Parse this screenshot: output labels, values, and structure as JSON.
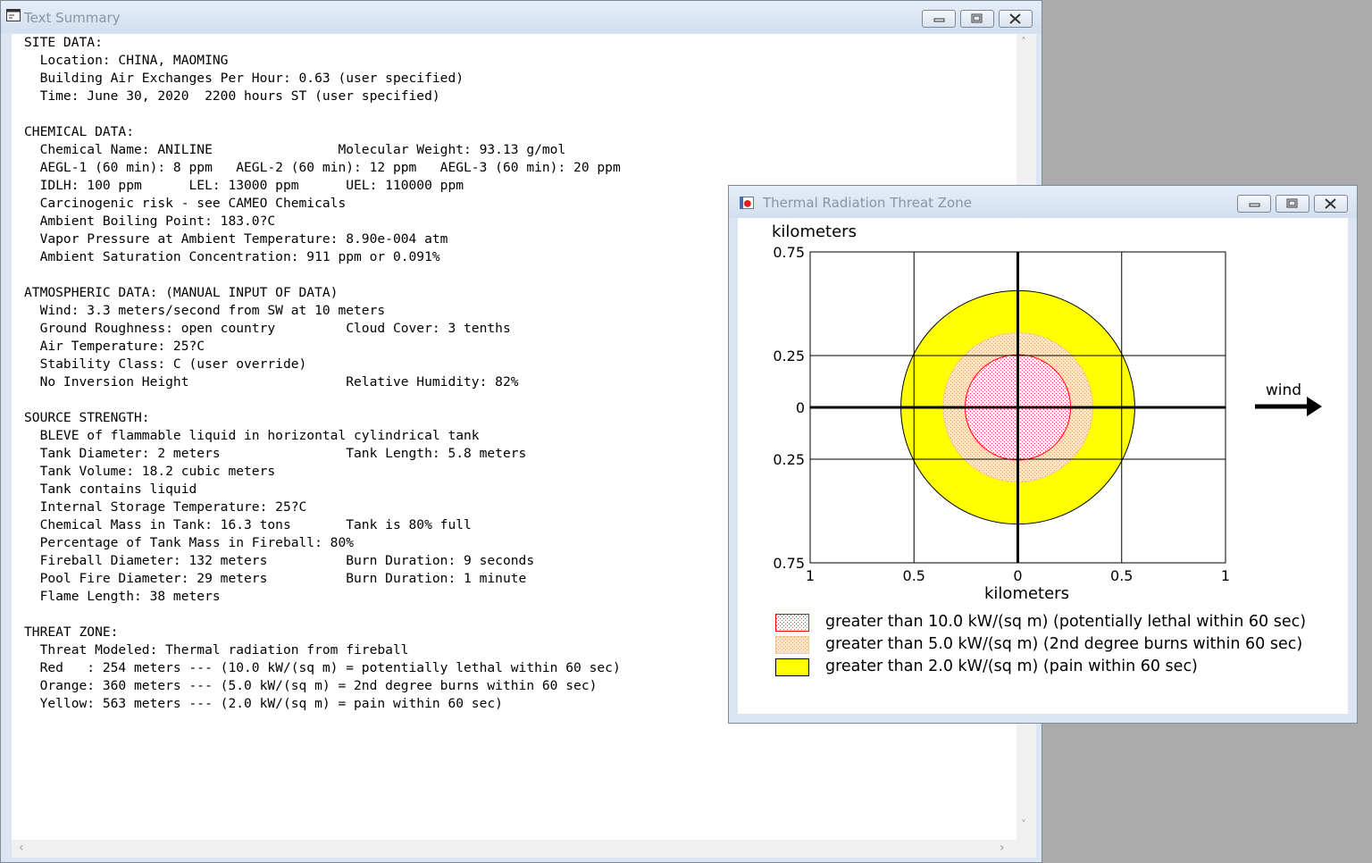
{
  "text_summary": {
    "title": "Text Summary",
    "lines": [
      "SITE DATA:",
      "  Location: CHINA, MAOMING",
      "  Building Air Exchanges Per Hour: 0.63 (user specified)",
      "  Time: June 30, 2020  2200 hours ST (user specified)",
      "",
      "CHEMICAL DATA:",
      "  Chemical Name: ANILINE                Molecular Weight: 93.13 g/mol",
      "  AEGL-1 (60 min): 8 ppm   AEGL-2 (60 min): 12 ppm   AEGL-3 (60 min): 20 ppm",
      "  IDLH: 100 ppm      LEL: 13000 ppm      UEL: 110000 ppm",
      "  Carcinogenic risk - see CAMEO Chemicals",
      "  Ambient Boiling Point: 183.0?C",
      "  Vapor Pressure at Ambient Temperature: 8.90e-004 atm",
      "  Ambient Saturation Concentration: 911 ppm or 0.091%",
      "",
      "ATMOSPHERIC DATA: (MANUAL INPUT OF DATA)",
      "  Wind: 3.3 meters/second from SW at 10 meters",
      "  Ground Roughness: open country         Cloud Cover: 3 tenths",
      "  Air Temperature: 25?C",
      "  Stability Class: C (user override)",
      "  No Inversion Height                    Relative Humidity: 82%",
      "",
      "SOURCE STRENGTH:",
      "  BLEVE of flammable liquid in horizontal cylindrical tank",
      "  Tank Diameter: 2 meters                Tank Length: 5.8 meters",
      "  Tank Volume: 18.2 cubic meters",
      "  Tank contains liquid",
      "  Internal Storage Temperature: 25?C",
      "  Chemical Mass in Tank: 16.3 tons       Tank is 80% full",
      "  Percentage of Tank Mass in Fireball: 80%",
      "  Fireball Diameter: 132 meters          Burn Duration: 9 seconds",
      "  Pool Fire Diameter: 29 meters          Burn Duration: 1 minute",
      "  Flame Length: 38 meters",
      "",
      "THREAT ZONE:",
      "  Threat Modeled: Thermal radiation from fireball",
      "  Red   : 254 meters --- (10.0 kW/(sq m) = potentially lethal within 60 sec)",
      "  Orange: 360 meters --- (5.0 kW/(sq m) = 2nd degree burns within 60 sec)",
      "  Yellow: 563 meters --- (2.0 kW/(sq m) = pain within 60 sec)"
    ]
  },
  "threat_window": {
    "title": "Thermal Radiation Threat Zone",
    "y_axis_title": "kilometers",
    "x_axis_title": "kilometers",
    "y_tick_labels": [
      "0.75",
      "0.25",
      "0",
      "0.25",
      "0.75"
    ],
    "x_tick_labels": [
      "1",
      "0.5",
      "0",
      "0.5",
      "1"
    ],
    "wind_label": "wind",
    "legend": [
      {
        "text": "greater than 10.0 kW/(sq m) (potentially lethal within 60 sec)",
        "color": "#ff0000",
        "fill": "dotted-red"
      },
      {
        "text": "greater than 5.0 kW/(sq m) (2nd degree burns within 60 sec)",
        "color": "#f7c58a",
        "fill": "dotted-orange"
      },
      {
        "text": "greater than 2.0 kW/(sq m) (pain within 60 sec)",
        "color": "#ffff00",
        "fill": "solid-yellow"
      }
    ]
  },
  "chart_data": {
    "type": "scatter",
    "xlim": [
      -1,
      1
    ],
    "ylim": [
      -0.75,
      0.75
    ],
    "xlabel": "kilometers",
    "ylabel": "kilometers",
    "zones": [
      {
        "name": "Red",
        "radius_km": 0.254,
        "color": "#ff0000"
      },
      {
        "name": "Orange",
        "radius_km": 0.36,
        "color": "#f7c58a"
      },
      {
        "name": "Yellow",
        "radius_km": 0.563,
        "color": "#ffff00"
      }
    ],
    "wind_direction": "east"
  }
}
